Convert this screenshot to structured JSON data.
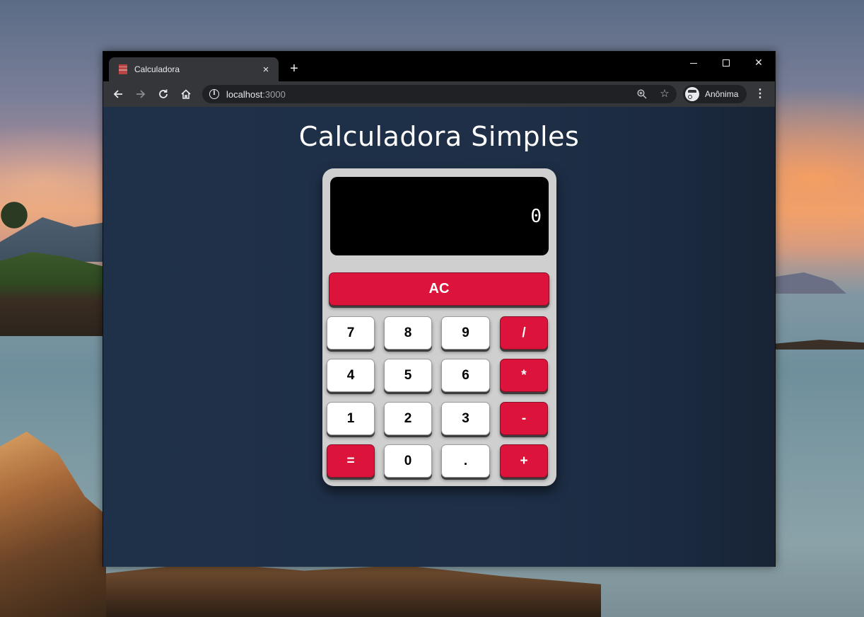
{
  "browser": {
    "tab_title": "Calculadora",
    "tab_close": "×",
    "new_tab": "+",
    "window_close": "✕",
    "url_host": "localhost",
    "url_port": ":3000",
    "profile_label": "Anônima",
    "icons": {
      "back": "arrow-left-icon",
      "forward": "arrow-right-icon",
      "reload": "reload-icon",
      "home": "home-icon",
      "info": "info-icon",
      "zoom": "zoom-icon",
      "bookmark": "star-icon",
      "profile": "incognito-icon",
      "menu": "kebab-menu-icon"
    }
  },
  "page": {
    "title": "Calculadora Simples"
  },
  "calculator": {
    "display_value": "0",
    "clear_label": "AC",
    "keys": {
      "k7": "7",
      "k8": "8",
      "k9": "9",
      "div": "/",
      "k4": "4",
      "k5": "5",
      "k6": "6",
      "mul": "*",
      "k1": "1",
      "k2": "2",
      "k3": "3",
      "sub": "-",
      "eq": "=",
      "k0": "0",
      "dot": ".",
      "add": "+"
    },
    "colors": {
      "operator": "#dc143c",
      "number": "#ffffff",
      "body": "#cfcfcf",
      "display": "#000000",
      "page_background": "#1f3049"
    }
  }
}
